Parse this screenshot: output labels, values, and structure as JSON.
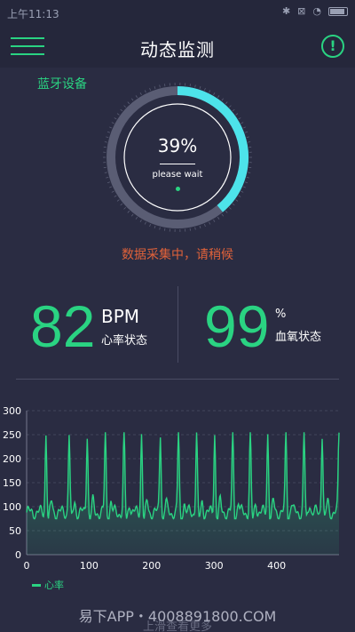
{
  "status_bar": {
    "time": "上午11:13"
  },
  "header": {
    "title": "动态监测"
  },
  "bluetooth": {
    "label": "蓝牙设备"
  },
  "gauge": {
    "percent": "39%",
    "progress": 0.39,
    "wait_text": "please wait",
    "color": "#4de3ea"
  },
  "collect": {
    "status": "数据采集中，请稍候"
  },
  "heart": {
    "value": "82",
    "unit": "BPM",
    "label": "心率状态"
  },
  "spo2": {
    "value": "99",
    "unit": "%",
    "label": "血氧状态"
  },
  "colors": {
    "accent": "#2ad382",
    "background": "#2a2c42",
    "warning": "#e0623a"
  },
  "chart_data": {
    "type": "line",
    "title": "",
    "xlabel": "",
    "ylabel": "",
    "xlim": [
      0,
      500
    ],
    "ylim": [
      0,
      300
    ],
    "x_ticks": [
      "0",
      "100",
      "200",
      "300",
      "400"
    ],
    "y_ticks": [
      "0",
      "50",
      "100",
      "150",
      "200",
      "250",
      "300"
    ],
    "grid": true,
    "legend": "bottom-left",
    "series": [
      {
        "name": "心率",
        "color": "#2ad382",
        "peaks_x": [
          31,
          68,
          97,
          126,
          156,
          184,
          214,
          243,
          272,
          301,
          330,
          358,
          386,
          415,
          444,
          473,
          500
        ],
        "peak_value": 255,
        "baseline": 88,
        "trough": 75
      }
    ]
  },
  "footer": {
    "watermark": "易下APP・4008891800.COM",
    "sub": "上滑查看更多"
  }
}
